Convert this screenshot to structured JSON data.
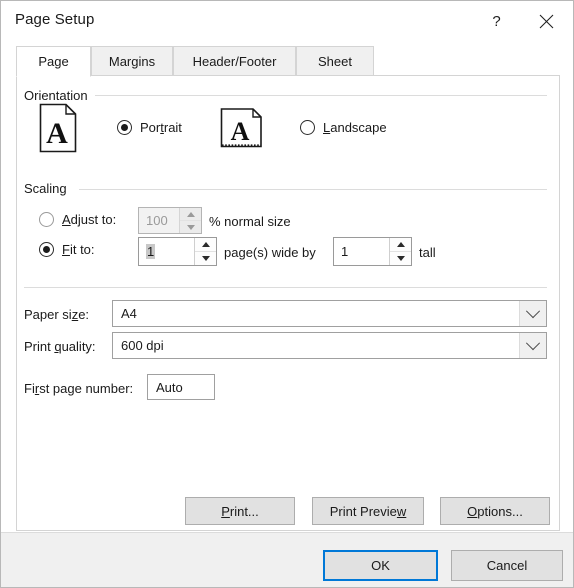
{
  "window": {
    "title": "Page Setup",
    "help_icon": "help-icon",
    "close_icon": "close-icon",
    "help_glyph": "?"
  },
  "tabs": [
    {
      "label": "Page",
      "active": true
    },
    {
      "label": "Margins",
      "active": false
    },
    {
      "label": "Header/Footer",
      "active": false
    },
    {
      "label": "Sheet",
      "active": false
    }
  ],
  "orientation": {
    "group_label": "Orientation",
    "options": [
      {
        "label": "Portrait",
        "accel": "t",
        "selected": true,
        "icon": "portrait-page-icon"
      },
      {
        "label": "Landscape",
        "accel": "L",
        "selected": false,
        "icon": "landscape-page-icon"
      }
    ]
  },
  "scaling": {
    "group_label": "Scaling",
    "adjust_to": {
      "label": "Adjust to:",
      "accel": "A",
      "selected": false,
      "enabled": false,
      "value": "100",
      "suffix": "% normal size"
    },
    "fit_to": {
      "label": "Fit to:",
      "accel": "F",
      "selected": true,
      "enabled": true,
      "pages_wide": "1",
      "middle_text": "page(s) wide by",
      "pages_tall": "1",
      "suffix": "tall"
    }
  },
  "paper_size": {
    "label": "Paper size:",
    "accel": "z",
    "value": "A4"
  },
  "print_quality": {
    "label": "Print quality:",
    "accel": "q",
    "value": "600 dpi"
  },
  "first_page_number": {
    "label": "First page number:",
    "accel": "r",
    "value": "Auto"
  },
  "action_buttons": [
    {
      "label": "Print...",
      "name": "print-button"
    },
    {
      "label": "Print Preview",
      "name": "print-preview-button"
    },
    {
      "label": "Options...",
      "name": "options-button"
    }
  ],
  "footer_buttons": [
    {
      "label": "OK",
      "name": "ok-button",
      "default": true
    },
    {
      "label": "Cancel",
      "name": "cancel-button",
      "default": false
    }
  ],
  "colors": {
    "accent": "#0078d7",
    "dialog_bg": "#ffffff",
    "footer_bg": "#f0f0f0",
    "button_face": "#e1e1e1",
    "disabled_text": "#9a9a9a"
  }
}
